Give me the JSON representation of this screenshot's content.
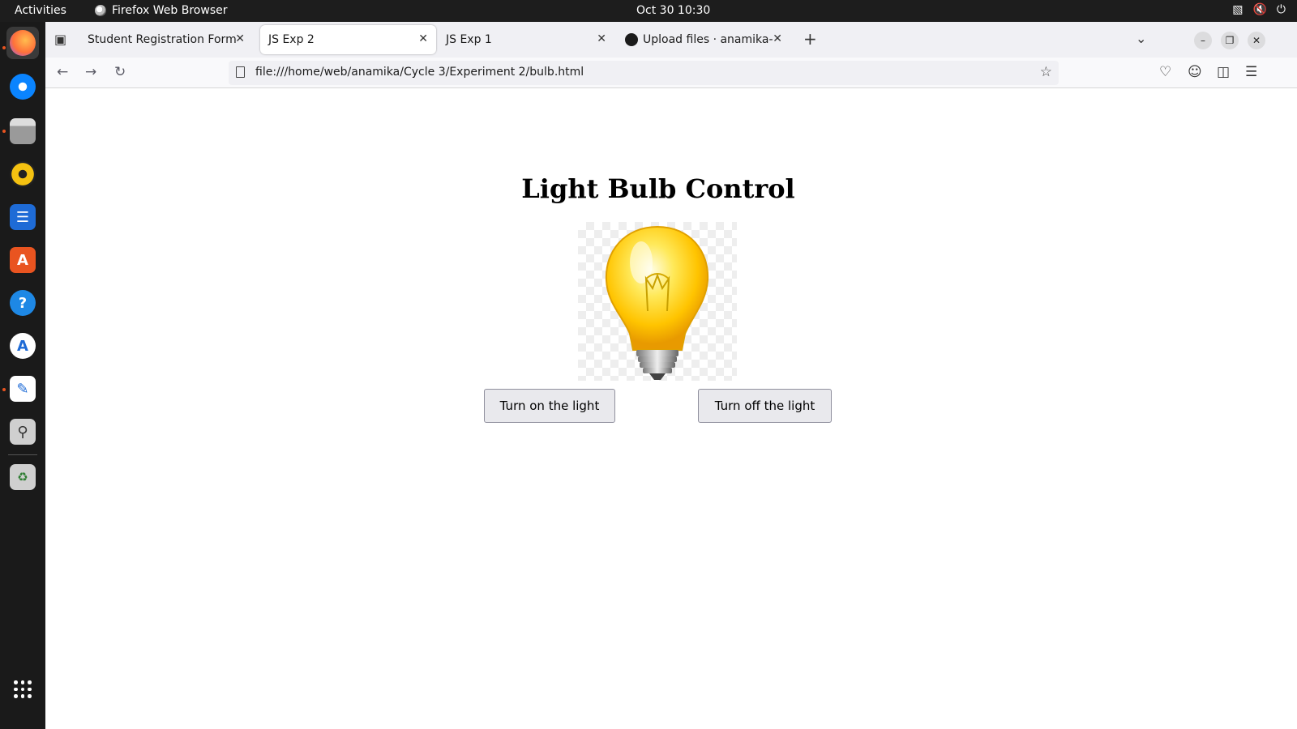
{
  "topbar": {
    "activities": "Activities",
    "app_name": "Firefox Web Browser",
    "clock": "Oct 30  10:30",
    "tray_icons": [
      "network-icon",
      "volume-muted-icon",
      "power-icon"
    ]
  },
  "dock": {
    "items": [
      "firefox-icon",
      "thunderbird-icon",
      "files-icon",
      "rhythmbox-icon",
      "writer-icon",
      "app-center-icon",
      "help-icon",
      "software-icon",
      "text-editor-icon",
      "search-icon",
      "trash-icon",
      "show-apps-icon"
    ]
  },
  "tabs": [
    {
      "label": "Student Registration Form",
      "active": false
    },
    {
      "label": "JS Exp 2",
      "active": true
    },
    {
      "label": "JS Exp 1",
      "active": false
    },
    {
      "label": "Upload files · anamika-rit",
      "active": false
    }
  ],
  "navbar": {
    "url": "file:///home/web/anamika/Cycle 3/Experiment 2/bulb.html"
  },
  "page": {
    "title": "Light Bulb Control",
    "on_button": "Turn on the light",
    "off_button": "Turn off the light",
    "bulb_state": "on"
  },
  "colors": {
    "topbar": "#1d1d1d",
    "dock": "#1a1a1a",
    "accent": "#e95420",
    "bulb_glass": "#ffd21a",
    "button_bg": "#e9e9ed"
  }
}
